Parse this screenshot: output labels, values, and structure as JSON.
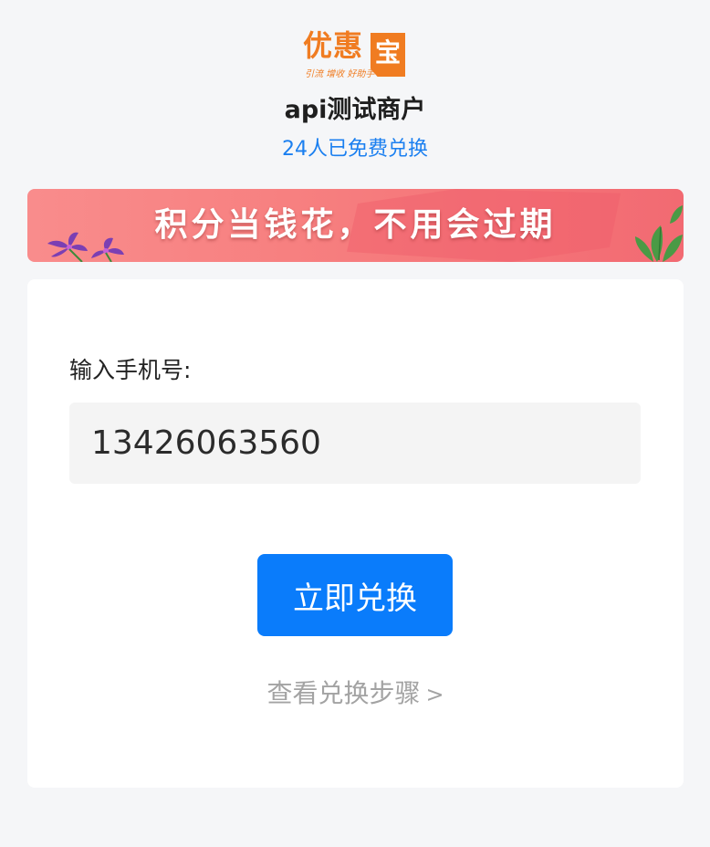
{
  "logo": {
    "text": "优惠",
    "box_char": "宝",
    "slogan": "引流 增收 好助手",
    "color": "#f07c21"
  },
  "merchant": {
    "name": "api测试商户",
    "redeem_count": "24人已免费兑换"
  },
  "banner": {
    "text": "积分当钱花，不用会过期",
    "icons": [
      "flower-icon",
      "leaf-icon"
    ]
  },
  "form": {
    "phone_label": "输入手机号:",
    "phone_value": "13426063560",
    "submit_label": "立即兑换",
    "steps_link": "查看兑换步骤",
    "steps_chevron": ">"
  },
  "colors": {
    "accent": "#0a7cfb",
    "link": "#1a7ff0",
    "background": "#f5f6f8"
  }
}
